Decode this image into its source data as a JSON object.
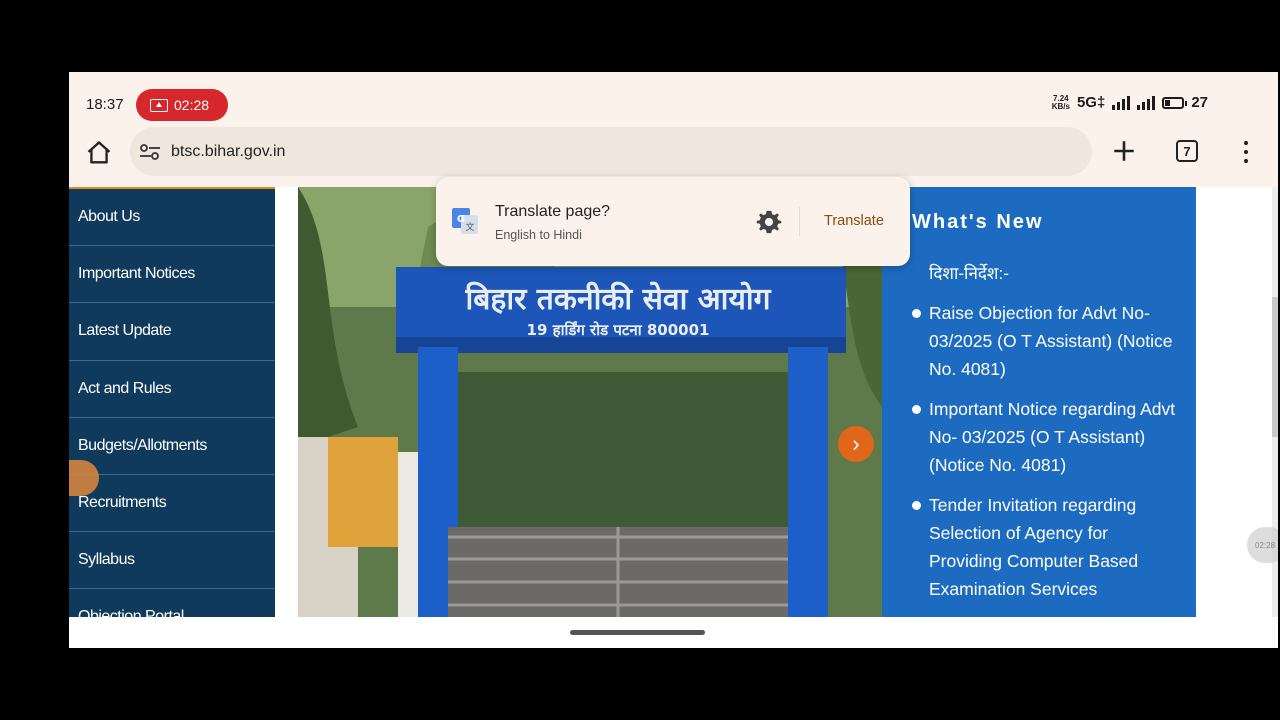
{
  "status": {
    "time": "18:37",
    "recording_time": "02:28",
    "speed_value": "7.24",
    "speed_unit": "KB/s",
    "network": "5G‡",
    "battery": "27"
  },
  "browser": {
    "url": "btsc.bihar.gov.in",
    "tab_count": "7"
  },
  "sidebar": {
    "items": [
      {
        "label": "About Us"
      },
      {
        "label": "Important Notices"
      },
      {
        "label": "Latest Update"
      },
      {
        "label": "Act and Rules"
      },
      {
        "label": "Budgets/Allotments"
      },
      {
        "label": "Recruitments"
      },
      {
        "label": "Syllabus"
      },
      {
        "label": "Objection Portal"
      }
    ]
  },
  "banner": {
    "sign_title": "बिहार तकनीकी सेवा आयोग",
    "sign_address": "19 हार्डिंग रोड पटना 800001"
  },
  "whats_new": {
    "title": "What's New",
    "partial_line": "दिशा-निर्देश:-",
    "items": [
      "Raise Objection for Advt No-03/2025 (O T Assistant) (Notice No. 4081)",
      "Important Notice regarding Advt No- 03/2025 (O T Assistant) (Notice No. 4081)",
      "Tender Invitation regarding Selection of Agency for Providing Computer Based Examination Services"
    ]
  },
  "translate_popup": {
    "title": "Translate page?",
    "subtitle": "English to Hindi",
    "button": "Translate"
  },
  "overlay": {
    "side_bubble_time": "02:28"
  }
}
